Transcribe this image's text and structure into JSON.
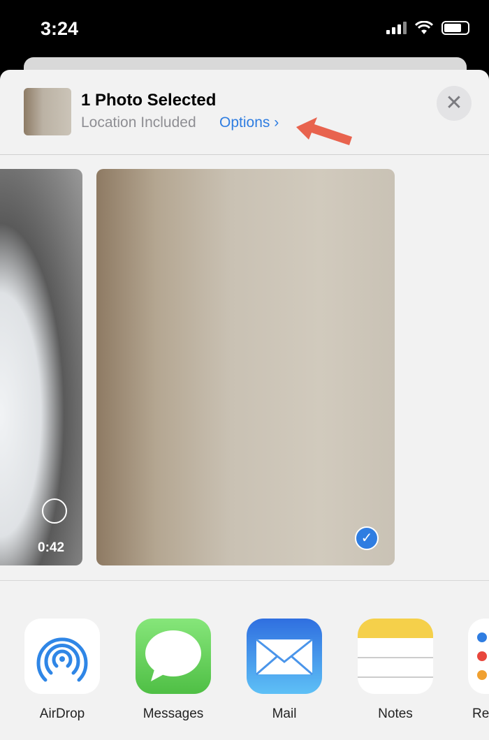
{
  "status_bar": {
    "time": "3:24",
    "icons": [
      "cellular-signal-icon",
      "wifi-icon",
      "battery-icon"
    ]
  },
  "header": {
    "title": "1 Photo Selected",
    "subtitle": "Location Included",
    "options_label": "Options",
    "options_chevron": "›",
    "close_icon": "✕"
  },
  "photos": [
    {
      "type": "video",
      "duration": "0:42",
      "selected": false
    },
    {
      "type": "photo",
      "selected": true
    }
  ],
  "apps": [
    {
      "label": "AirDrop"
    },
    {
      "label": "Messages"
    },
    {
      "label": "Mail"
    },
    {
      "label": "Notes"
    },
    {
      "label": "Re"
    }
  ],
  "colors": {
    "accent": "#2f7de1",
    "annotation_arrow": "#e8634e"
  }
}
